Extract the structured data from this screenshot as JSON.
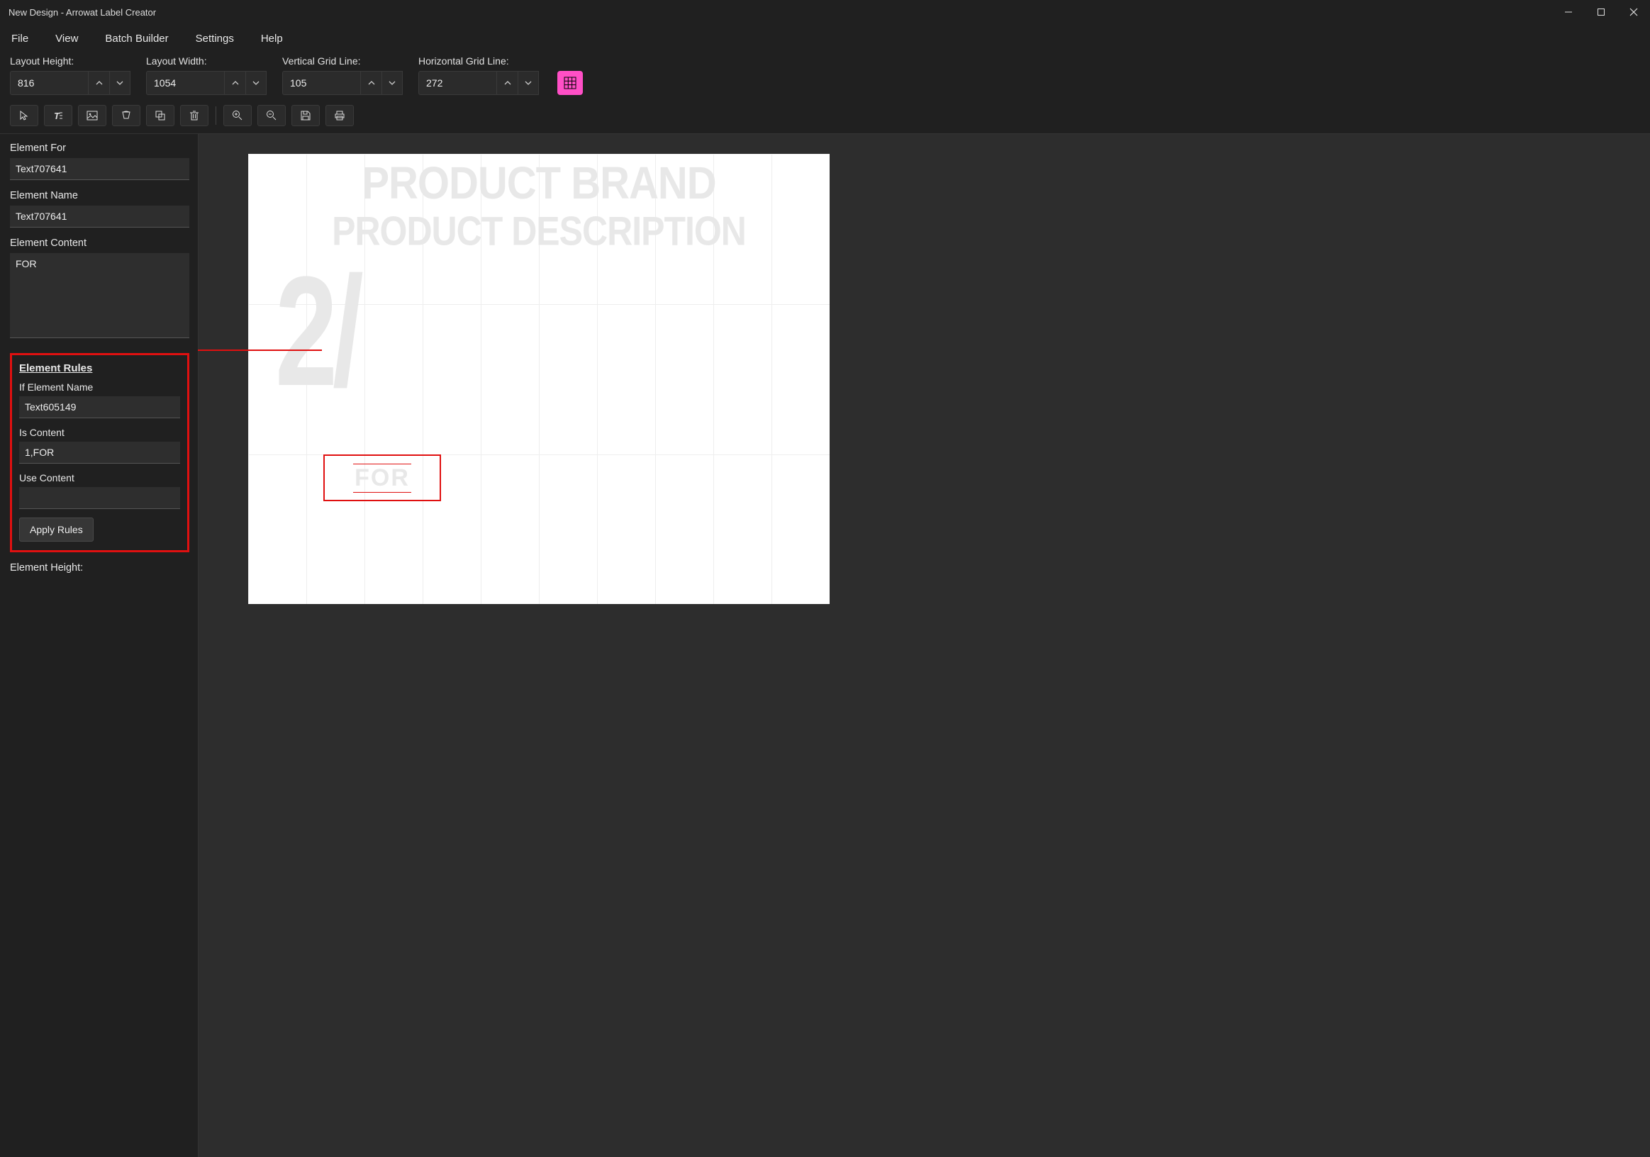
{
  "window": {
    "title": "New Design - Arrowat Label Creator"
  },
  "menubar": {
    "items": [
      "File",
      "View",
      "Batch Builder",
      "Settings",
      "Help"
    ]
  },
  "layoutbar": {
    "height_label": "Layout Height:",
    "height_value": "816",
    "width_label": "Layout Width:",
    "width_value": "1054",
    "vgrid_label": "Vertical Grid Line:",
    "vgrid_value": "105",
    "hgrid_label": "Horizontal Grid Line:",
    "hgrid_value": "272"
  },
  "sidebar": {
    "element_for_label": "Element For",
    "element_for_value": "Text707641",
    "element_name_label": "Element Name",
    "element_name_value": "Text707641",
    "element_content_label": "Element Content",
    "element_content_value": "FOR",
    "rules_header": "Element Rules",
    "rules_if_label": "If Element Name",
    "rules_if_value": "Text605149",
    "rules_is_label": "Is Content",
    "rules_is_value": "1,FOR",
    "rules_use_label": "Use Content",
    "rules_use_value": "",
    "apply_label": "Apply Rules",
    "element_height_label": "Element Height:"
  },
  "canvas": {
    "brand": "PRODUCT BRAND",
    "desc": "PRODUCT DESCRIPTION",
    "bignum": "2/",
    "for_text": "FOR"
  }
}
